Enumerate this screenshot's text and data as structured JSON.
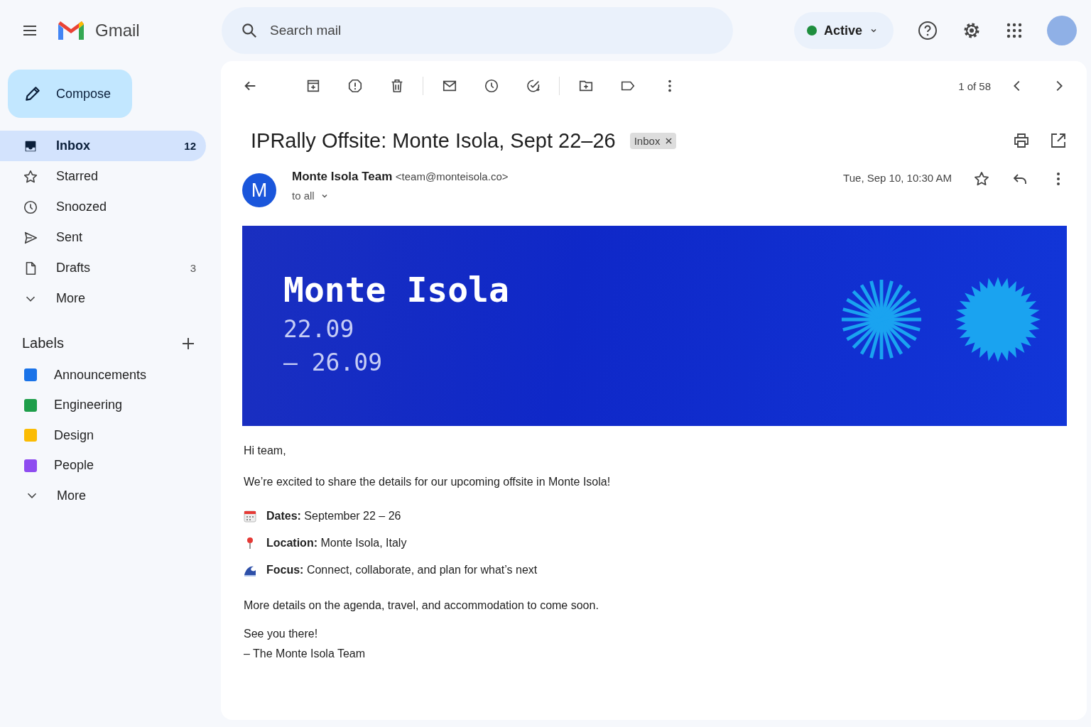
{
  "app": {
    "name": "Gmail"
  },
  "search": {
    "placeholder": "Search mail"
  },
  "status": {
    "label": "Active",
    "color": "#1e8e3e"
  },
  "compose": {
    "label": "Compose"
  },
  "nav": [
    {
      "kind": "inbox",
      "label": "Inbox",
      "count": "12",
      "selected": true
    },
    {
      "kind": "starred",
      "label": "Starred",
      "selected": false
    },
    {
      "kind": "snoozed",
      "label": "Snoozed",
      "selected": false
    },
    {
      "kind": "sent",
      "label": "Sent",
      "selected": false
    },
    {
      "kind": "drafts",
      "label": "Drafts",
      "count": "3",
      "selected": false
    },
    {
      "kind": "more",
      "label": "More",
      "selected": false
    }
  ],
  "labels": {
    "title": "Labels",
    "items": [
      {
        "label": "Announcements",
        "color": "#1a73e8"
      },
      {
        "label": "Engineering",
        "color": "#1e9e4a"
      },
      {
        "label": "Design",
        "color": "#fbbc04"
      },
      {
        "label": "People",
        "color": "#8e4cf0"
      }
    ],
    "more": "More"
  },
  "toolbar": {
    "pager": "1 of 58"
  },
  "message": {
    "subject": "IPRally Offsite: Monte Isola, Sept 22–26",
    "tag": "Inbox",
    "sender_initial": "M",
    "sender_name": "Monte Isola Team",
    "sender_email": "<team@monteisola.co>",
    "recipients": "to all",
    "date": "Tue, Sep 10, 10:30 AM",
    "banner": {
      "title": "Monte Isola",
      "date_start": "22.09",
      "date_end": "— 26.09"
    },
    "greeting": "Hi team,",
    "intro": "We’re excited to share the details for our upcoming offsite in Monte Isola!",
    "details": [
      {
        "kind": "calendar",
        "text": "**Dates:** September 22 – 26"
      },
      {
        "kind": "pin",
        "text": "**Location:** Monte Isola, Italy"
      },
      {
        "kind": "wave",
        "text": "**Focus:** Connect, collaborate, and plan for what’s next"
      }
    ],
    "closing": "More details on the agenda, travel, and accommodation to come soon.",
    "signoff": [
      "See you there!",
      "– The Monte Isola Team"
    ]
  }
}
